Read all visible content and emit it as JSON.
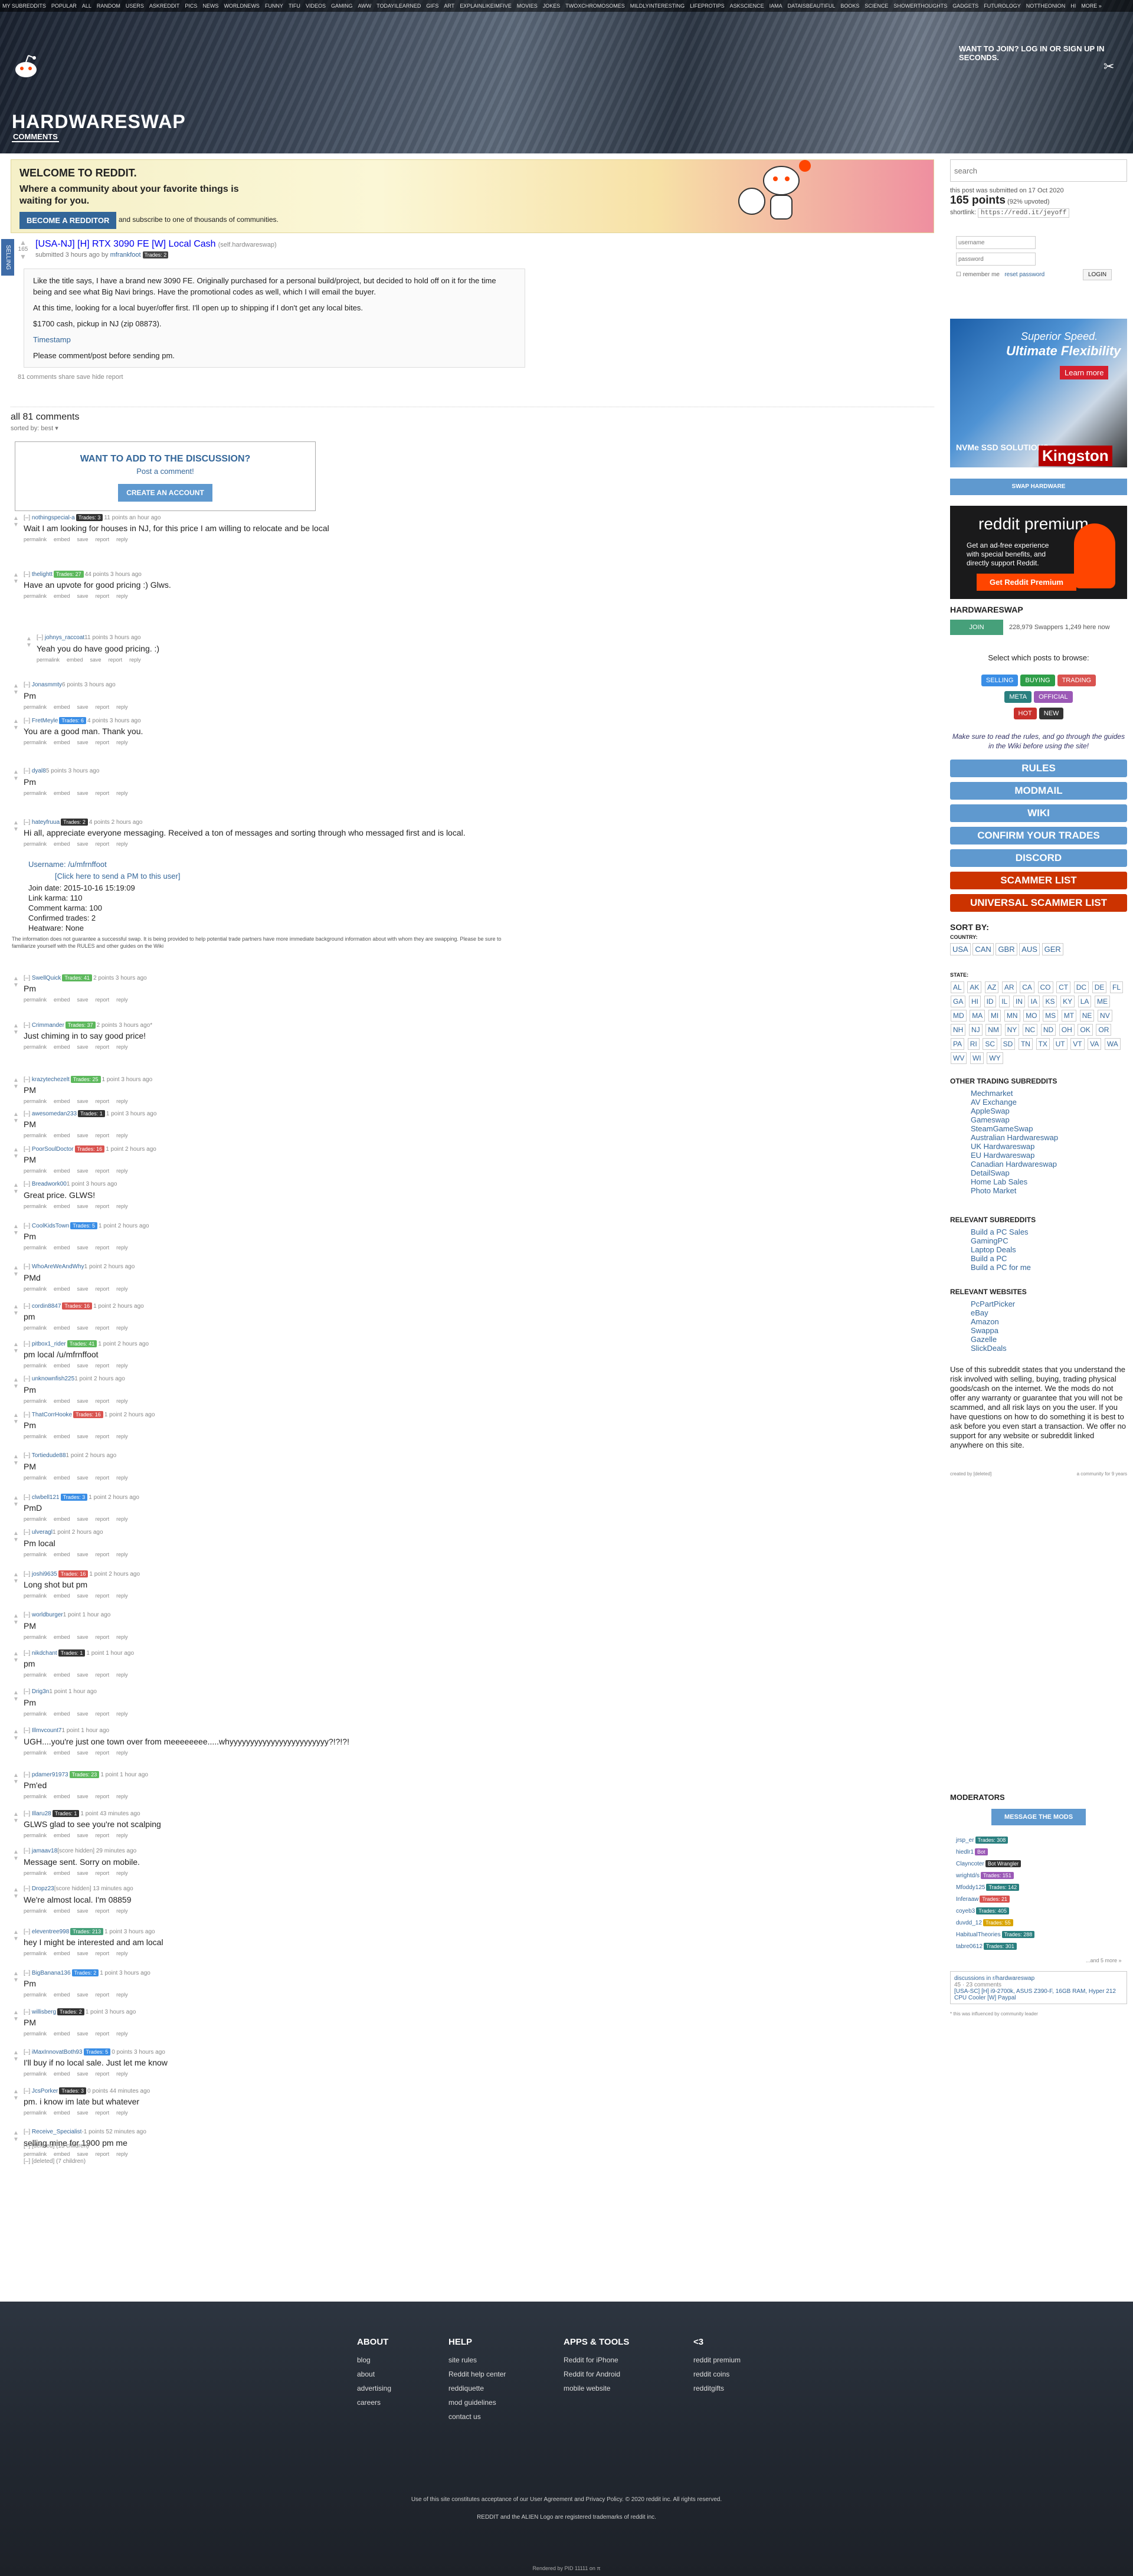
{
  "header": {
    "subreddit_bar": [
      "MY SUBREDDITS",
      "POPULAR",
      "ALL",
      "RANDOM",
      "USERS",
      "ASKREDDIT",
      "PICS",
      "NEWS",
      "WORLDNEWS",
      "FUNNY",
      "TIFU",
      "VIDEOS",
      "GAMING",
      "AWW",
      "TODAYILEARNED",
      "GIFS",
      "ART",
      "EXPLAINLIKEIMFIVE",
      "MOVIES",
      "JOKES",
      "TWOXCHROMOSOMES",
      "MILDLYINTERESTING",
      "LIFEPROTIPS",
      "ASKSCIENCE",
      "IAMA",
      "DATAISBEAUTIFUL",
      "BOOKS",
      "SCIENCE",
      "SHOWERTHOUGHTS",
      "GADGETS",
      "FUTUROLOGY",
      "NOTTHEONION",
      "HI",
      "MORE »"
    ],
    "title": "HARDWARESWAP",
    "tab": "COMMENTS",
    "login_hint": "WANT TO JOIN? LOG IN OR SIGN UP IN SECONDS."
  },
  "banner": {
    "title": "WELCOME TO REDDIT.",
    "tagline": "Where a community about your favorite things is waiting for you.",
    "button": "BECOME A REDDITOR",
    "sub": "and subscribe to one of thousands of communities."
  },
  "sidebar_tab": "SELLING",
  "post": {
    "score": "165",
    "title": "[USA-NJ] [H] RTX 3090 FE [W] Local Cash",
    "domain": "(self.hardwareswap)",
    "submitted": "submitted 3 hours ago by",
    "author": "mfrankfoot",
    "flair": "Trades: 2",
    "body": [
      "Like the title says, I have a brand new 3090 FE. Originally purchased for a personal build/project, but decided to hold off on it for the time being and see what Big Navi brings. Have the promotional codes as well, which I will email the buyer.",
      "At this time, looking for a local buyer/offer first. I'll open up to shipping if I don't get any local bites.",
      "$1700 cash, pickup in NJ (zip 08873).",
      "Timestamp",
      "Please comment/post before sending pm."
    ],
    "links": "81 comments   share   save   hide   report"
  },
  "comments_header": "all 81 comments",
  "sorted": "sorted by: best ▾",
  "discuss": {
    "title": "WANT TO ADD TO THE DISCUSSION?",
    "link": "Post a comment!",
    "button": "CREATE AN ACCOUNT"
  },
  "comments": [
    {
      "user": "nothingspecial-a",
      "flair": "Trades: 3",
      "fc": "#333",
      "meta": "11 points an hour ago",
      "text": "Wait I am looking for houses in NJ, for this price I am willing to relocate and be local"
    },
    {
      "user": "thelightt",
      "flair": "Trades: 27",
      "fc": "#5cb85c",
      "meta": "44 points 3 hours ago",
      "text": "Have an upvote for good pricing :) Glws."
    },
    {
      "user": "johnys_raccoat",
      "flair": "",
      "fc": "",
      "meta": "11 points 3 hours ago",
      "text": "Yeah you do have good pricing. :)"
    },
    {
      "user": "Jonasmmty",
      "flair": "",
      "fc": "",
      "meta": "6 points 3 hours ago",
      "text": "Pm"
    },
    {
      "user": "FretMeyle",
      "flair": "Trades: 6",
      "fc": "#3a8ee6",
      "meta": "4 points 3 hours ago",
      "text": "You are a good man. Thank you."
    },
    {
      "user": "dyal8",
      "flair": "",
      "fc": "",
      "meta": "5 points 3 hours ago",
      "text": "Pm"
    },
    {
      "user": "hateyfruua",
      "flair": "Trades: 2",
      "fc": "#333",
      "meta": "4 points 2 hours ago",
      "text": "Hi all, appreciate everyone messaging. Received a ton of messages and sorting through who messaged first and is local."
    },
    {
      "user": "SwellQuick",
      "flair": "Trades: 41",
      "fc": "#5cb85c",
      "meta": "2 points 3 hours ago",
      "text": "Pm"
    },
    {
      "user": "Crimmander",
      "flair": "Trades: 37",
      "fc": "#5cb85c",
      "meta": "2 points 3 hours ago*",
      "text": "Just chiming in to say good price!"
    },
    {
      "user": "krazytechezelt",
      "flair": "Trades: 25",
      "fc": "#5cb85c",
      "meta": "1 point 3 hours ago",
      "text": "PM"
    },
    {
      "user": "awesomedan233",
      "flair": "Trades: 1",
      "fc": "#333",
      "meta": "1 point 3 hours ago",
      "text": "PM"
    },
    {
      "user": "PoorSoulDoctor",
      "flair": "Trades: 16",
      "fc": "#d9534f",
      "meta": "1 point 2 hours ago",
      "text": "PM"
    },
    {
      "user": "Breadwork00",
      "flair": "",
      "fc": "",
      "meta": "1 point 3 hours ago",
      "text": "Great price. GLWS!"
    },
    {
      "user": "CoolKidsTown",
      "flair": "Trades: 5",
      "fc": "#3a8ee6",
      "meta": "1 point 2 hours ago",
      "text": "Pm"
    },
    {
      "user": "WhoAreWeAndWhy",
      "flair": "",
      "fc": "",
      "meta": "1 point 2 hours ago",
      "text": "PMd"
    },
    {
      "user": "cordin8847",
      "flair": "Trades: 16",
      "fc": "#d9534f",
      "meta": "1 point 2 hours ago",
      "text": "pm"
    },
    {
      "user": "pitbox1_rider",
      "flair": "Trades: 41",
      "fc": "#5cb85c",
      "meta": "1 point 2 hours ago",
      "text": "pm local /u/mfrnffoot"
    },
    {
      "user": "unknownfish225",
      "flair": "",
      "fc": "",
      "meta": "1 point 2 hours ago",
      "text": "Pm"
    },
    {
      "user": "ThatCorrHooke",
      "flair": "Trades: 16",
      "fc": "#d9534f",
      "meta": "1 point 2 hours ago",
      "text": "Pm"
    },
    {
      "user": "Tortiedude88",
      "flair": "",
      "fc": "",
      "meta": "1 point 2 hours ago",
      "text": "PM"
    },
    {
      "user": "clwbell121",
      "flair": "Trades: 3",
      "fc": "#3a8ee6",
      "meta": "1 point 2 hours ago",
      "text": "PmD"
    },
    {
      "user": "ulveragl",
      "flair": "",
      "fc": "",
      "meta": "1 point 2 hours ago",
      "text": "Pm local"
    },
    {
      "user": "joshi9635",
      "flair": "Trades: 16",
      "fc": "#d9534f",
      "meta": "1 point 2 hours ago",
      "text": "Long shot but pm"
    },
    {
      "user": "worldburger",
      "flair": "",
      "fc": "",
      "meta": "1 point 1 hour ago",
      "text": "PM"
    },
    {
      "user": "nikdchant",
      "flair": "Trades: 1",
      "fc": "#333",
      "meta": "1 point 1 hour ago",
      "text": "pm"
    },
    {
      "user": "Drig3n",
      "flair": "",
      "fc": "",
      "meta": "1 point 1 hour ago",
      "text": "Pm"
    },
    {
      "user": "Illmvcount7",
      "flair": "",
      "fc": "",
      "meta": "1 point 1 hour ago",
      "text": "UGH....you're just one town over from meeeeeeee.....whyyyyyyyyyyyyyyyyyyyyyyyy?!?!?!"
    },
    {
      "user": "pdamer91973",
      "flair": "Trades: 23",
      "fc": "#5cb85c",
      "meta": "1 point 1 hour ago",
      "text": "Pm'ed"
    },
    {
      "user": "Illaru28",
      "flair": "Trades: 1",
      "fc": "#333",
      "meta": "1 point 43 minutes ago",
      "text": "GLWS glad to see you're not scalping"
    },
    {
      "user": "jamaav18",
      "flair": "",
      "fc": "",
      "meta": "[score hidden] 29 minutes ago",
      "text": "Message sent. Sorry on mobile."
    },
    {
      "user": "Dropz23",
      "flair": "",
      "fc": "",
      "meta": "[score hidden] 13 minutes ago",
      "text": "We're almost local. I'm 08859"
    },
    {
      "user": "eleventree998",
      "flair": "Trades: 213",
      "fc": "#46a07a",
      "meta": "1 point 3 hours ago",
      "text": "hey I might be interested and am local"
    },
    {
      "user": "BigBanana136",
      "flair": "Trades: 2",
      "fc": "#3a8ee6",
      "meta": "1 point 3 hours ago",
      "text": "Pm"
    },
    {
      "user": "willisberg",
      "flair": "Trades: 2",
      "fc": "#333",
      "meta": "1 point 3 hours ago",
      "text": "PM"
    },
    {
      "user": "iMaxInnovatBoth93",
      "flair": "Trades: 5",
      "fc": "#3a8ee6",
      "meta": "0 points 3 hours ago",
      "text": "I'll buy if no local sale. Just let me know"
    },
    {
      "user": "JcsPorker",
      "flair": "Trades: 3",
      "fc": "#333",
      "meta": "0 points 44 minutes ago",
      "text": "pm. i know im late but whatever"
    },
    {
      "user": "Receive_Specialist",
      "flair": "",
      "fc": "",
      "meta": "-1 points 52 minutes ago",
      "text": "selling mine for 1900 pm me"
    }
  ],
  "helper_text": "The information does not guarantee a successful swap. It is being provided to help potential trade partners have more immediate background information about with whom they are swapping. Please be sure to familiarize yourself with the RULES and other guides on the Wiki",
  "user_info": {
    "username": "Username: /u/mfrnffoot",
    "pm": "[Click here to send a PM to this user]",
    "items": [
      "Join date: 2015-10-16 15:19:09",
      "Link karma: 110",
      "Comment karma: 100",
      "Confirmed trades: 2",
      "Heatware: None"
    ]
  },
  "deleted": [
    "[–] [deleted] (13 children)",
    "[–] [deleted] (7 children)"
  ],
  "sidebar": {
    "search_placeholder": "search",
    "submitted_line": "this post was submitted on 17 Oct 2020",
    "points": "165 points",
    "upvoted": "(92% upvoted)",
    "shortlink_label": "shortlink:",
    "shortlink": "https://redd.it/jeyoff",
    "username_ph": "username",
    "password_ph": "password",
    "remember": "remember me",
    "reset": "reset password",
    "login": "LOGIN",
    "ad1": {
      "t1": "Superior Speed.",
      "t2": "Ultimate Flexibility",
      "learn": "Learn more",
      "nv": "NVMe SSD SOLUTIONS",
      "ks": "Kingston"
    },
    "swap_btn": "SWAP HARDWARE",
    "ad2": {
      "logo": "reddit premium",
      "desc": "Get an ad-free experience with special benefits, and directly support Reddit.",
      "btn": "Get Reddit Premium"
    },
    "sr": "HARDWARESWAP",
    "join": "JOIN",
    "subs": "228,979 Swappers   1,249 here now",
    "select": "Select which posts to browse:",
    "tags1": [
      {
        "l": "SELLING",
        "c": "#3a8ee6"
      },
      {
        "l": "BUYING",
        "c": "#2e9e48"
      },
      {
        "l": "TRADING",
        "c": "#d9534f"
      }
    ],
    "tags2": [
      {
        "l": "META",
        "c": "#2a7f7f"
      },
      {
        "l": "OFFICIAL",
        "c": "#9b59b6"
      }
    ],
    "tags3": [
      {
        "l": "HOT",
        "c": "#c9302c"
      },
      {
        "l": "NEW",
        "c": "#333"
      }
    ],
    "rules_text": "Make sure to read the rules, and go through the guides in the Wiki before using the site!",
    "buttons": [
      {
        "l": "RULES",
        "c": "#5f99cf"
      },
      {
        "l": "MODMAIL",
        "c": "#5f99cf"
      },
      {
        "l": "WIKI",
        "c": "#5f99cf"
      },
      {
        "l": "CONFIRM YOUR TRADES",
        "c": "#5f99cf"
      },
      {
        "l": "DISCORD",
        "c": "#5f99cf"
      },
      {
        "l": "SCAMMER LIST",
        "c": "#cc3300"
      },
      {
        "l": "UNIVERSAL SCAMMER LIST",
        "c": "#cc3300"
      }
    ],
    "sortby": "SORT BY:",
    "country": "COUNTRY:",
    "countries": [
      "USA",
      "CAN",
      "GBR",
      "AUS",
      "GER"
    ],
    "state": "STATE:",
    "states": [
      "AL",
      "AK",
      "AZ",
      "AR",
      "CA",
      "CO",
      "CT",
      "DC",
      "DE",
      "FL",
      "GA",
      "HI",
      "ID",
      "IL",
      "IN",
      "IA",
      "KS",
      "KY",
      "LA",
      "ME",
      "MD",
      "MA",
      "MI",
      "MN",
      "MO",
      "MS",
      "MT",
      "NE",
      "NV",
      "NH",
      "NJ",
      "NM",
      "NY",
      "NC",
      "ND",
      "OH",
      "OK",
      "OR",
      "PA",
      "RI",
      "SC",
      "SD",
      "TN",
      "TX",
      "UT",
      "VT",
      "VA",
      "WA",
      "WV",
      "WI",
      "WY"
    ],
    "other_h": "OTHER TRADING SUBREDDITS",
    "other": [
      "Mechmarket",
      "AV Exchange",
      "AppleSwap",
      "Gameswap",
      "SteamGameSwap",
      "Australian Hardwareswap",
      "UK Hardwareswap",
      "EU Hardwareswap",
      "Canadian Hardwareswap",
      "DetailSwap",
      "Home Lab Sales",
      "Photo Market"
    ],
    "rel_h": "RELEVANT SUBREDDITS",
    "rel": [
      "Build a PC Sales",
      "GamingPC",
      "Laptop Deals",
      "Build a PC",
      "Build a PC for me"
    ],
    "web_h": "RELEVANT WEBSITES",
    "web": [
      "PcPartPicker",
      "eBay",
      "Amazon",
      "Swappa",
      "Gazelle",
      "SlickDeals"
    ],
    "disclaimer": "Use of this subreddit states that you understand the risk involved with selling, buying, trading physical goods/cash on the internet. We the mods do not offer any warranty or guarantee that you will not be scammed, and all risk lays on you the user. If you have questions on how to do something it is best to ask before you even start a transaction. We offer no support for any website or subreddit linked anywhere on this site.",
    "created": "created by [deleted]",
    "community": "a community for 9 years",
    "mods_h": "MODERATORS",
    "msg_mods": "MESSAGE THE MODS",
    "mods": [
      {
        "n": "jrsp_er",
        "f": "Trades: 308",
        "c": "#2a7f7f"
      },
      {
        "n": "hiedlr1",
        "f": "Bot",
        "c": "#9b59b6"
      },
      {
        "n": "Clayncoter",
        "f": "Bot Wrangler",
        "c": "#333"
      },
      {
        "n": "wrightd/s",
        "f": "Trades: 151",
        "c": "#9b59b6"
      },
      {
        "n": "Mfoddy125",
        "f": "Trades: 142",
        "c": "#2a7f7f"
      },
      {
        "n": "Inferaaw",
        "f": "Trades: 21",
        "c": "#d9534f"
      },
      {
        "n": "coyeb3",
        "f": "Trades: 405",
        "c": "#2a7f7f"
      },
      {
        "n": "duvdd_12",
        "f": "Trades: 55",
        "c": "#d9a400"
      },
      {
        "n": "HabitualTheories",
        "f": "Trades: 288",
        "c": "#2a7f7f"
      },
      {
        "n": "tabre0612",
        "f": "Trades: 301",
        "c": "#2a7f7f"
      }
    ],
    "mods_more": "...and 5 more »",
    "disc_h": "discussions in r/hardwareswap",
    "disc_items": [
      "45 · 23 comments",
      "[USA-SC] [H] i9-2700k, ASUS Z390-F, 16GB RAM, Hyper 212 CPU Cooler [W] Paypal"
    ],
    "disc_footer": "* this was influenced by community leader"
  },
  "footer": {
    "about": {
      "h": "ABOUT",
      "items": [
        "blog",
        "about",
        "advertising",
        "careers"
      ]
    },
    "help": {
      "h": "HELP",
      "items": [
        "site rules",
        "Reddit help center",
        "reddiquette",
        "mod guidelines",
        "contact us"
      ]
    },
    "apps": {
      "h": "APPS & TOOLS",
      "items": [
        "Reddit for iPhone",
        "Reddit for Android",
        "mobile website"
      ]
    },
    "love": {
      "h": "<3",
      "items": [
        "reddit premium",
        "reddit coins",
        "redditgifts"
      ]
    },
    "copy": "Use of this site constitutes acceptance of our User Agreement and Privacy Policy. © 2020 reddit inc. All rights reserved.",
    "copy2": "REDDIT and the ALIEN Logo are registered trademarks of reddit inc.",
    "copy3": "Rendered by PID 11111 on   π"
  }
}
